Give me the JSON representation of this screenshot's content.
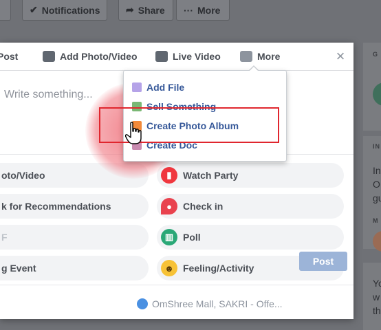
{
  "topbar": {
    "notifications_label": "Notifications",
    "share_label": "Share",
    "more_label": "More"
  },
  "tabs": {
    "post_label": "Post",
    "add_photo_video_label": "Add Photo/Video",
    "live_video_label": "Live Video",
    "more_label": "More"
  },
  "composer": {
    "placeholder": "Write something..."
  },
  "dropdown": {
    "items": [
      {
        "label": "Add File"
      },
      {
        "label": "Sell Something"
      },
      {
        "label": "Create Photo Album"
      },
      {
        "label": "Create Doc"
      }
    ]
  },
  "options": {
    "photo_video": "oto/Video",
    "watch_party": "Watch Party",
    "recommendations": "k for Recommendations",
    "check_in": "Check in",
    "gif": "F",
    "poll": "Poll",
    "event": "g Event",
    "feeling_activity": "Feeling/Activity"
  },
  "footer": {
    "audience": "OmShree Mall, SAKRI - Offe...",
    "post_button": "Post"
  },
  "right_column": {
    "small_header_1": "IN",
    "line_1": "In",
    "line_2": "O",
    "line_3": "gu",
    "small_header_2": "M",
    "line_4": "Yo",
    "line_5": "w",
    "line_6": "th"
  },
  "colors": {
    "accent": "#365899",
    "highlight_box": "#e0262e",
    "post_button": "#9cb4d8"
  }
}
